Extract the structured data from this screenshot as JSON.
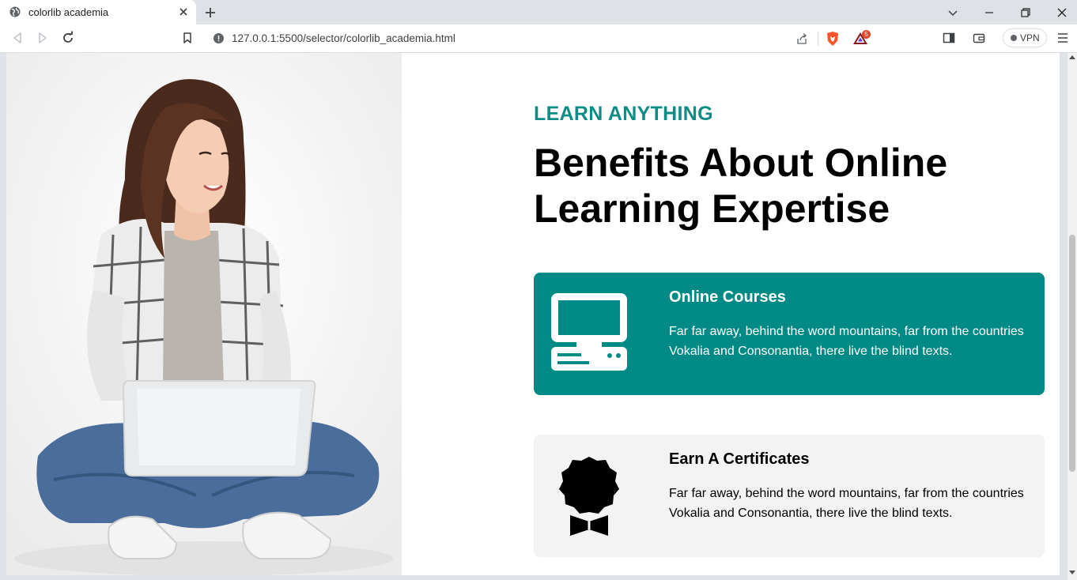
{
  "browser": {
    "tab_title": "colorlib academia",
    "url": "127.0.0.1:5500/selector/colorlib_academia.html",
    "rewards_badge": "5",
    "vpn_label": "VPN"
  },
  "page": {
    "eyebrow": "LEARN ANYTHING",
    "heading": "Benefits About Online Learning Expertise",
    "cards": [
      {
        "title": "Online Courses",
        "text": "Far far away, behind the word mountains, far from the countries Vokalia and Consonantia, there live the blind texts.",
        "icon": "computer-icon"
      },
      {
        "title": "Earn A Certificates",
        "text": "Far far away, behind the word mountains, far from the countries Vokalia and Consonantia, there live the blind texts.",
        "icon": "certificate-badge-icon"
      }
    ]
  },
  "colors": {
    "accent": "#0f8c86",
    "card_active_bg": "#008a86",
    "card_bg": "#f3f3f3"
  }
}
